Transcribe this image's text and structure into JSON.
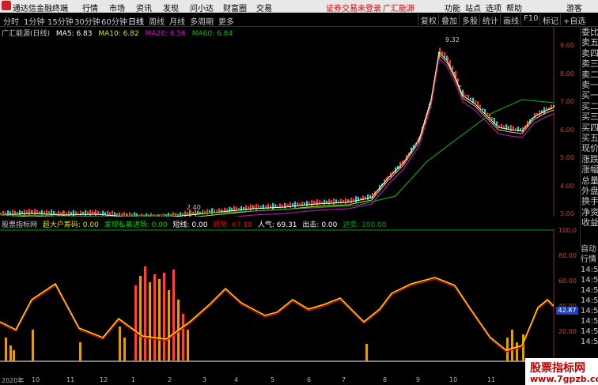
{
  "app": {
    "title": "通达信金融终端",
    "menus": [
      "行情",
      "市场",
      "资讯",
      "发现",
      "问小达",
      "财富圈",
      "交易"
    ],
    "login_warning": "证券交易未登录",
    "broker": "广汇能源",
    "right_menus": [
      "功能",
      "站点",
      "选项",
      "帮助"
    ],
    "guest": "游客"
  },
  "periods": [
    "分时",
    "1分钟",
    "15分钟",
    "30分钟",
    "60分钟",
    "日线",
    "周线",
    "月线",
    "多周期",
    "更多"
  ],
  "active_period": "日线",
  "toolbar": [
    "复权",
    "叠加",
    "多股",
    "统计",
    "画线",
    "F10",
    "标记",
    "+自选"
  ],
  "ma_legend": {
    "name": "广汇能源(日线)",
    "ma5": "MA5: 6.83",
    "ma10": "MA10: 6.82",
    "ma20": "MA20: 6.56",
    "ma60": "MA60: 6.84"
  },
  "price_axis": [
    "9.00",
    "8.00",
    "7.00",
    "6.00",
    "5.00",
    "4.00",
    "3.00"
  ],
  "price_annotations": {
    "high": "9.32",
    "low": "2.40"
  },
  "indicator_legend": {
    "name": "股票指标网",
    "items": [
      {
        "label": "超大户筹码: 0.00",
        "color": "#e0e000"
      },
      {
        "label": "发现私募进场: 0.00",
        "color": "#00d000"
      },
      {
        "label": "短线: 0.00",
        "color": "#ffffff"
      },
      {
        "label": "趋势: 67.18",
        "color": "#e00000"
      },
      {
        "label": "人气: 69.31",
        "color": "#ffffff"
      },
      {
        "label": "出击: 0.00",
        "color": "#ffffff"
      },
      {
        "label": "进卖: 100.00",
        "color": "#00a000"
      }
    ]
  },
  "indicator_axis": [
    "100.0",
    "80.00",
    "60.00",
    "40.00",
    "20.00"
  ],
  "indicator_value_tag": "42.87",
  "right_panel": [
    "委比",
    "卖五",
    "卖四",
    "卖三",
    "卖二",
    "卖一",
    "买一",
    "买二",
    "买三",
    "买四",
    "买五",
    "现价",
    "涨跌",
    "涨幅",
    "总量",
    "外盘",
    "换手",
    "净资",
    "收益"
  ],
  "right_panel2": [
    "自动",
    "行情",
    "14:5",
    "14:5",
    "14:5",
    "14:5",
    "14:5",
    "14:5",
    "14:5",
    "14:5"
  ],
  "dates": [
    "2020年",
    "10",
    "11",
    "12",
    "1",
    "2",
    "3",
    "4",
    "5",
    "6",
    "7",
    "8",
    "9",
    "10",
    "11"
  ],
  "watermark": {
    "line1": "股票指标网",
    "line2": "www.7gpzb.com"
  },
  "colors": {
    "up": "#ff3232",
    "down": "#00e0e0",
    "ma5": "#ffffff",
    "ma10": "#e0e000",
    "ma20": "#e000e0",
    "ma60": "#00c000"
  }
}
